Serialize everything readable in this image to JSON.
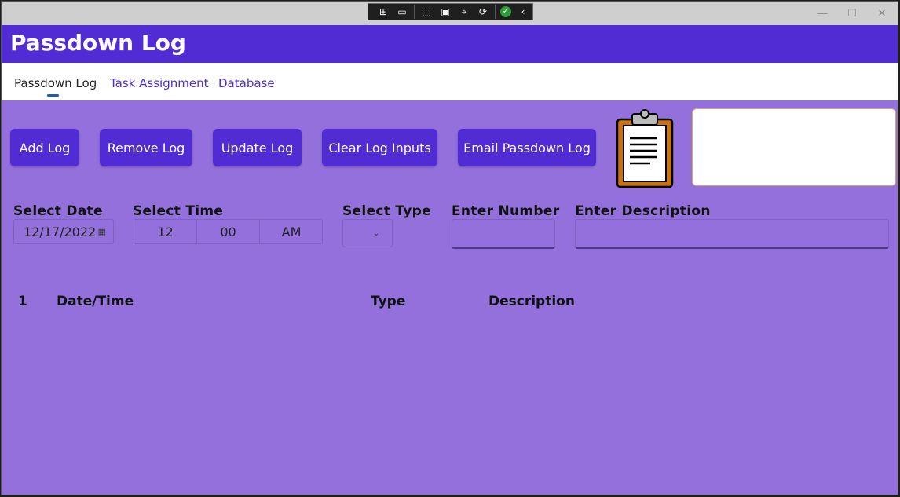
{
  "window": {
    "minimize_glyph": "—",
    "maximize_glyph": "☐",
    "close_glyph": "✕"
  },
  "header": {
    "title": "Passdown Log"
  },
  "debug_toolbar": {
    "icons": [
      "live-visual-tree-icon",
      "record-icon",
      "select-element-icon",
      "display-layout-adorners-icon",
      "track-focus-icon",
      "hot-reload-icon",
      "binding-check-icon",
      "collapse-chevron-icon"
    ]
  },
  "tabs": [
    {
      "label": "Passdown Log",
      "active": true
    },
    {
      "label": "Task Assignment",
      "active": false
    },
    {
      "label": "Database",
      "active": false
    }
  ],
  "buttons": {
    "add": "Add Log",
    "remove": "Remove Log",
    "update": "Update Log",
    "clear": "Clear Log Inputs",
    "email": "Email Passdown Log"
  },
  "form": {
    "date_label": "Select Date",
    "date_value": "12/17/2022",
    "time_label": "Select Time",
    "time_hour": "12",
    "time_minute": "00",
    "time_period": "AM",
    "type_label": "Select Type",
    "number_label": "Enter Number",
    "number_value": "",
    "description_label": "Enter Description",
    "description_value": ""
  },
  "log_table": {
    "columns": [
      "1",
      "Date/Time",
      "Type",
      "Description"
    ]
  },
  "colors": {
    "header": "#512bd4",
    "background": "#9370db",
    "button": "#512bd4"
  }
}
